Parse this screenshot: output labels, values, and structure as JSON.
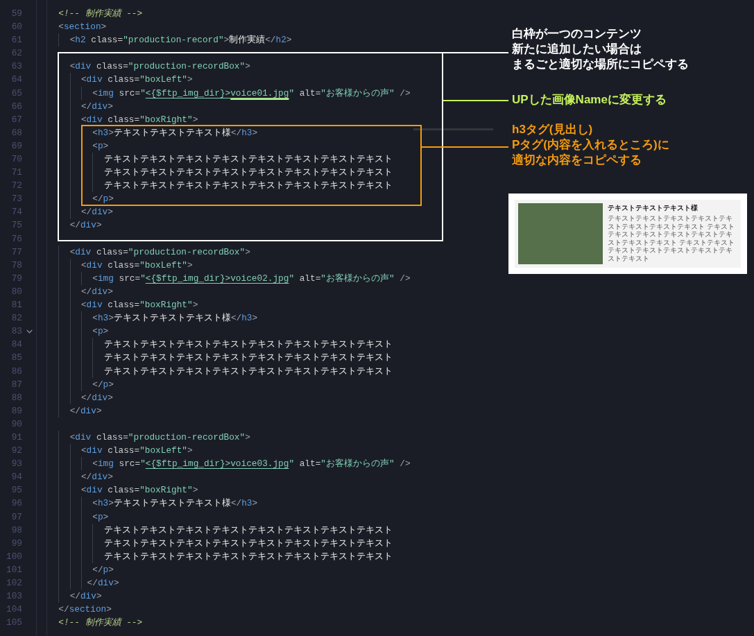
{
  "editor": {
    "lines": [
      {
        "number": "59",
        "text": "  <!-- 制作実績 -->"
      },
      {
        "number": "60",
        "text": "  <section>"
      },
      {
        "number": "61",
        "text": "    <h2 class=\"production-record\">制作実績</h2>"
      },
      {
        "number": "62"
      },
      {
        "number": "63",
        "text": "    <div class=\"production-recordBox\">"
      },
      {
        "number": "64",
        "text": "      <div class=\"boxLeft\">"
      },
      {
        "number": "65",
        "text": "        <img src=\"<{$ftp_img_dir}>voice01.jpg\" alt=\"お客様からの声\" />",
        "marked": true
      },
      {
        "number": "66",
        "text": "      </div>"
      },
      {
        "number": "67",
        "text": "      <div class=\"boxRight\">"
      },
      {
        "number": "68",
        "text": "        <h3>テキストテキストテキスト様</h3>"
      },
      {
        "number": "69",
        "text": "        <p>"
      },
      {
        "number": "70",
        "text": "          テキストテキストテキストテキストテキストテキストテキストテキスト"
      },
      {
        "number": "71",
        "text": "          テキストテキストテキストテキストテキストテキストテキストテキスト"
      },
      {
        "number": "72",
        "text": "          テキストテキストテキストテキストテキストテキストテキストテキスト"
      },
      {
        "number": "73",
        "text": "        </p>"
      },
      {
        "number": "74",
        "text": "      </div>"
      },
      {
        "number": "75",
        "text": "    </div>"
      },
      {
        "number": "76"
      },
      {
        "number": "77",
        "text": "    <div class=\"production-recordBox\">"
      },
      {
        "number": "78",
        "text": "      <div class=\"boxLeft\">"
      },
      {
        "number": "79",
        "text": "        <img src=\"<{$ftp_img_dir}>voice02.jpg\" alt=\"お客様からの声\" />",
        "marked": false
      },
      {
        "number": "80",
        "text": "      </div>"
      },
      {
        "number": "81",
        "text": "      <div class=\"boxRight\">"
      },
      {
        "number": "82",
        "text": "        <h3>テキストテキストテキスト様</h3>"
      },
      {
        "number": "83",
        "text": "        <p>",
        "expanded": true
      },
      {
        "number": "84",
        "text": "          テキストテキストテキストテキストテキストテキストテキストテキスト"
      },
      {
        "number": "85",
        "text": "          テキストテキストテキストテキストテキストテキストテキストテキスト"
      },
      {
        "number": "86",
        "text": "          テキストテキストテキストテキストテキストテキストテキストテキスト"
      },
      {
        "number": "87",
        "text": "        </p>"
      },
      {
        "number": "88",
        "text": "      </div>"
      },
      {
        "number": "89",
        "text": "    </div>"
      },
      {
        "number": "90"
      },
      {
        "number": "91",
        "text": "    <div class=\"production-recordBox\">"
      },
      {
        "number": "92",
        "text": "      <div class=\"boxLeft\">"
      },
      {
        "number": "93",
        "text": "        <img src=\"<{$ftp_img_dir}>voice03.jpg\" alt=\"お客様からの声\" />",
        "marked": false
      },
      {
        "number": "94",
        "text": "      </div>"
      },
      {
        "number": "95",
        "text": "      <div class=\"boxRight\">"
      },
      {
        "number": "96",
        "text": "        <h3>テキストテキストテキスト様</h3>"
      },
      {
        "number": "97",
        "text": "        <p>"
      },
      {
        "number": "98",
        "text": "          テキストテキストテキストテキストテキストテキストテキストテキスト"
      },
      {
        "number": "99",
        "text": "          テキストテキストテキストテキストテキストテキストテキストテキスト"
      },
      {
        "number": "100",
        "text": "          テキストテキストテキストテキストテキストテキストテキストテキスト"
      },
      {
        "number": "101",
        "text": "        </p>"
      },
      {
        "number": "102",
        "text": "       </div>"
      },
      {
        "number": "103",
        "text": "    </div>"
      },
      {
        "number": "104",
        "text": "  </section>"
      },
      {
        "number": "105",
        "text": "  <!-- 制作実績 -->"
      }
    ]
  },
  "annotations": [
    {
      "kind": "frame",
      "color": "#ffffff",
      "lines": [
        "白枠が一つのコンテンツ",
        "新たに追加したい場合は",
        "まるごと適切な場所にコピペする"
      ]
    },
    {
      "kind": "underline",
      "color": "#c6f25b",
      "lines": [
        "UPした画像Nameに変更する"
      ]
    },
    {
      "kind": "frame",
      "color": "#f59b0e",
      "lines": [
        "h3タグ(見出し)",
        "Pタグ(内容を入れるところ)に",
        "適切な内容をコピペする"
      ]
    }
  ],
  "preview": {
    "title": "テキストテキストテキスト様",
    "body": "テキストテキストテキストテキストテキストテキストテキストテキスト テキストテキストテキストテキストテキストテキストテキストテキスト テキストテキストテキストテキストテキストテキストテキストテキスト"
  }
}
